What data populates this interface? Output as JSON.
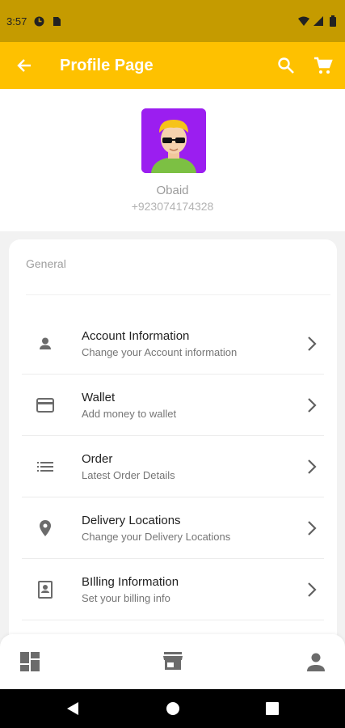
{
  "status_bar": {
    "time": "3:57"
  },
  "app_bar": {
    "title": "Profile Page"
  },
  "profile": {
    "name": "Obaid",
    "phone": "+923074174328"
  },
  "section": {
    "label": "General"
  },
  "menu": [
    {
      "title": "Account Information",
      "subtitle": "Change your Account information",
      "icon": "person-icon"
    },
    {
      "title": "Wallet",
      "subtitle": "Add money to wallet",
      "icon": "credit-card-icon"
    },
    {
      "title": "Order",
      "subtitle": "Latest Order Details",
      "icon": "list-icon"
    },
    {
      "title": "Delivery Locations",
      "subtitle": "Change your Delivery Locations",
      "icon": "location-pin-icon"
    },
    {
      "title": "BIlling Information",
      "subtitle": "Set your billing info",
      "icon": "billing-icon"
    }
  ],
  "colors": {
    "accent": "#fec100",
    "status_bar": "#c59b00",
    "avatar_bg": "#9b1ef0"
  }
}
